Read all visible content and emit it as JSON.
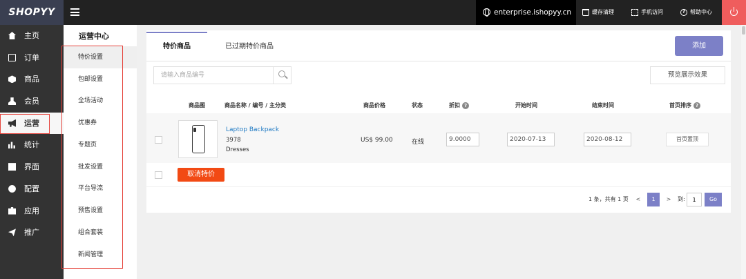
{
  "topbar": {
    "logo": "SHOPYY",
    "domain": "enterprise.ishopyy.cn",
    "tools": [
      {
        "label": "缓存清理",
        "icon": "trash-icon"
      },
      {
        "label": "手机访问",
        "icon": "scan-icon"
      },
      {
        "label": "帮助中心",
        "icon": "help-icon"
      }
    ],
    "power_icon": "power-icon"
  },
  "leftnav": {
    "items": [
      {
        "label": "主页",
        "icon": "home-icon"
      },
      {
        "label": "订单",
        "icon": "order-icon"
      },
      {
        "label": "商品",
        "icon": "box-icon"
      },
      {
        "label": "会员",
        "icon": "user-icon"
      },
      {
        "label": "运营",
        "icon": "megaphone-icon",
        "active": true
      },
      {
        "label": "统计",
        "icon": "bar-chart-icon"
      },
      {
        "label": "界面",
        "icon": "window-icon"
      },
      {
        "label": "配置",
        "icon": "gear-icon"
      },
      {
        "label": "应用",
        "icon": "puzzle-icon"
      },
      {
        "label": "推广",
        "icon": "send-icon"
      }
    ]
  },
  "subnav": {
    "title": "运营中心",
    "items": [
      {
        "label": "特价设置",
        "active": true
      },
      {
        "label": "包邮设置"
      },
      {
        "label": "全场活动"
      },
      {
        "label": "优惠券"
      },
      {
        "label": "专题页"
      },
      {
        "label": "批发设置"
      },
      {
        "label": "平台导流"
      },
      {
        "label": "预售设置"
      },
      {
        "label": "组合套装"
      },
      {
        "label": "新闻管理"
      }
    ]
  },
  "tabs": [
    {
      "label": "特价商品",
      "active": true
    },
    {
      "label": "已过期特价商品"
    }
  ],
  "toolbar": {
    "add_label": "添加",
    "search_placeholder": "请输入商品编号",
    "preview_label": "预览展示效果"
  },
  "table": {
    "headers": {
      "image": "商品图",
      "name": "商品名称 / 编号 / 主分类",
      "price": "商品价格",
      "status": "状态",
      "discount": "折扣",
      "start": "开始时间",
      "end": "结束时间",
      "sort": "首页排序"
    },
    "rows": [
      {
        "name": "Laptop Backpack",
        "code": "3978",
        "category": "Dresses",
        "price": "US$ 99.00",
        "status": "在线",
        "discount": "9.0000",
        "start": "2020-07-13",
        "end": "2020-08-12",
        "action": "首页置顶"
      }
    ],
    "cancel_label": "取消特价"
  },
  "pagination": {
    "summary": "1 条，共有 1 页",
    "prev": "<",
    "current": "1",
    "next": ">",
    "goto_label": "到:",
    "goto_value": "1",
    "go_label": "Go"
  },
  "colors": {
    "accent": "#7c80c7",
    "danger": "#f24a14",
    "highlight_box": "#e5423a",
    "link": "#1d79c3"
  }
}
